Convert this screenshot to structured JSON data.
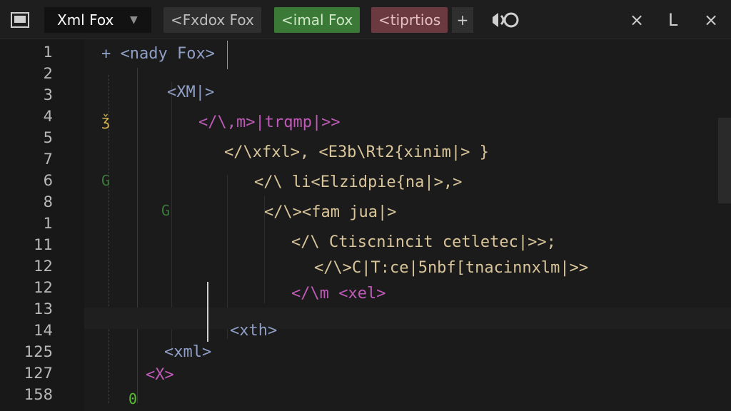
{
  "toolbar": {
    "active_tab": "Xml Fox",
    "tabs": [
      {
        "label": "<Fxdox Fox"
      },
      {
        "label": "<imal Fox"
      },
      {
        "label": "<tiprtios"
      }
    ],
    "colors": {
      "tab_grey": "#2f2f2f",
      "tab_green": "#3b7a36",
      "tab_red": "#6b3a40"
    }
  },
  "gutter": {
    "line_numbers": [
      "1",
      "2",
      "3",
      "4",
      "5",
      "7",
      "6",
      "8",
      "1",
      "11",
      "12",
      "12",
      "13",
      "14",
      "125",
      "127",
      "158"
    ],
    "markers": [
      "ǯ",
      "G",
      "G",
      "0"
    ]
  },
  "editor": {
    "lines": [
      {
        "text": "+ <nady Fox>"
      },
      {
        "text": "<XM|>"
      },
      {
        "text": "</\\,m>|trqmp|>>"
      },
      {
        "text": "</\\xfxl>, <E3b\\Rt2{xinim|> }"
      },
      {
        "text": "</\\ li<Elzidpie{na|>,>"
      },
      {
        "text": "</\\><fam jua|>"
      },
      {
        "text": "</\\ Ctiscnincit cetletec|>>;"
      },
      {
        "text": "</\\>C|T:ce|5nbf[tnacinnxlm|>>"
      },
      {
        "text": "</\\m <xel>"
      },
      {
        "text": "<xth>"
      },
      {
        "text": "<xml>"
      },
      {
        "text": "<X>"
      }
    ]
  }
}
